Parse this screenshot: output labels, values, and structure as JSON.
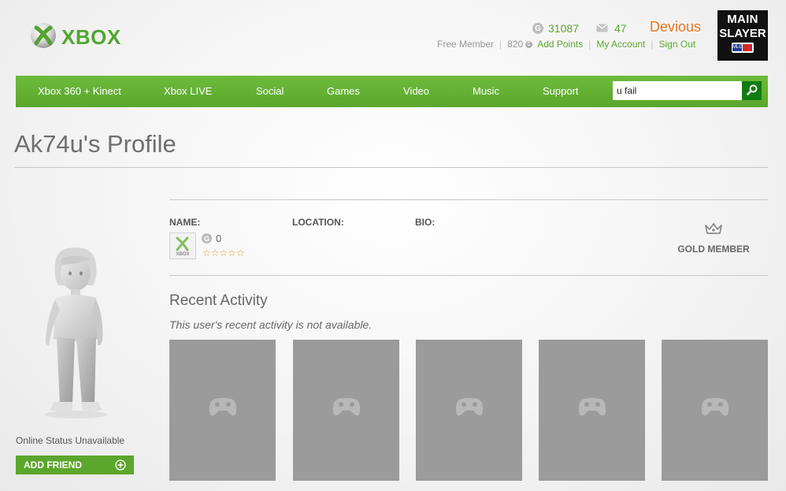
{
  "header": {
    "brand": "XBOX",
    "gamerscore": "31087",
    "messages": "47",
    "gamertag": "Devious",
    "membership": "Free Member",
    "ms_points": "820",
    "links": {
      "add_points": "Add Points",
      "my_account": "My Account",
      "sign_out": "Sign Out"
    },
    "gamerpic": {
      "line1": "MAIN",
      "line2": "SLAYER",
      "badge": "MLG"
    }
  },
  "nav": {
    "items": [
      "Xbox 360 + Kinect",
      "Xbox LIVE",
      "Social",
      "Games",
      "Video",
      "Music",
      "Support"
    ],
    "search_value": "u fail"
  },
  "profile": {
    "title": "Ak74u's Profile",
    "labels": {
      "name": "NAME:",
      "location": "LOCATION:",
      "bio": "BIO:"
    },
    "mini_pic_text": "XBOX",
    "reputation_score": "0",
    "reputation_stars": 0,
    "tier": "GOLD MEMBER",
    "online_status": "Online Status Unavailable",
    "add_friend": "ADD FRIEND"
  },
  "activity": {
    "heading": "Recent Activity",
    "note": "This user's recent activity is not available.",
    "tile_count": 5
  },
  "colors": {
    "brand_green": "#5ba62c",
    "gamertag_orange": "#e87722",
    "tile_gray": "#9b9b9b",
    "star_orange": "#e59b2d"
  }
}
